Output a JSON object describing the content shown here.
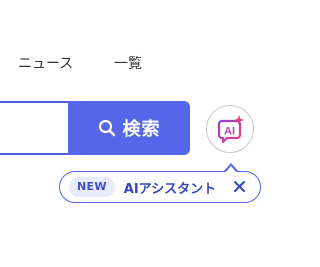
{
  "header": {
    "nav": [
      {
        "label": "ニュース"
      },
      {
        "label": "一覧"
      }
    ]
  },
  "search": {
    "input_value": "",
    "placeholder": "",
    "button_label": "検索",
    "button_icon": "search-icon"
  },
  "ai_button": {
    "icon": "ai-sparkle-icon",
    "icon_text": "AI"
  },
  "tooltip": {
    "badge": "NEW",
    "text": "AIアシスタント",
    "close_icon": "close-icon"
  },
  "colors": {
    "accent": "#5566e8",
    "accent_dark": "#3344c4",
    "badge_bg": "#e7ebfb",
    "ai_gradient_start": "#9b3fd8",
    "ai_gradient_end": "#e0407a"
  }
}
